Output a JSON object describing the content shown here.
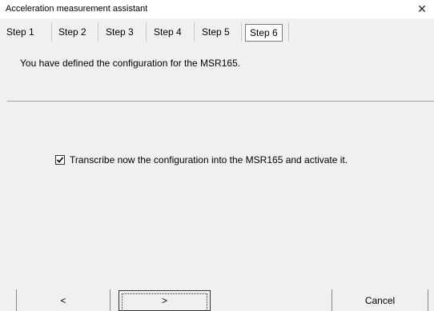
{
  "window": {
    "title": "Acceleration measurement assistant",
    "close_glyph": "✕"
  },
  "tabs": [
    {
      "label": "Step 1"
    },
    {
      "label": "Step 2"
    },
    {
      "label": "Step 3"
    },
    {
      "label": "Step 4"
    },
    {
      "label": "Step 5"
    },
    {
      "label": "Step 6",
      "selected": true
    }
  ],
  "main": {
    "info": "You have defined the configuration for the MSR165.",
    "checkbox": {
      "label": "Transcribe now the configuration into the MSR165 and activate it.",
      "checked": true
    }
  },
  "buttons": {
    "back_label": "<",
    "next_label": ">",
    "cancel_label": "Cancel"
  }
}
